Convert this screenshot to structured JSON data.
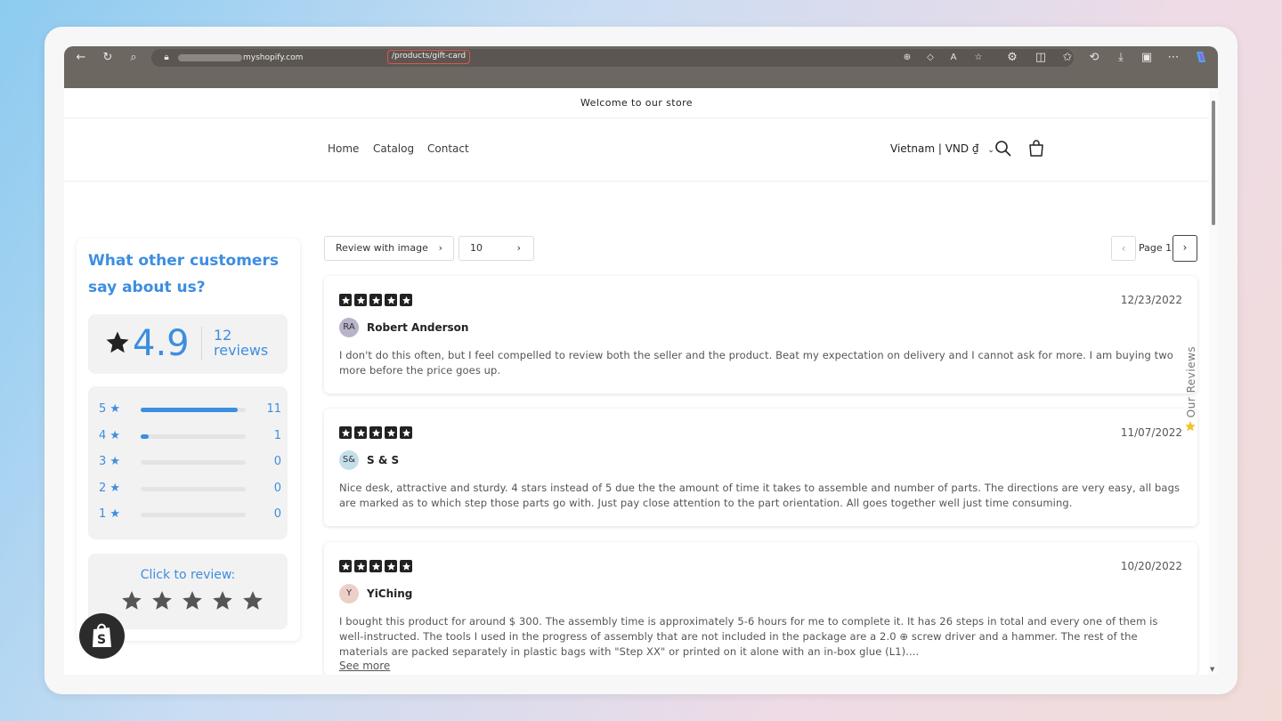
{
  "browser": {
    "url_domain": "myshopify.com",
    "url_path": "/products/gift-card"
  },
  "store": {
    "announcement": "Welcome to our store",
    "nav": [
      "Home",
      "Catalog",
      "Contact"
    ],
    "country": "Vietnam | VND ₫"
  },
  "summary": {
    "title": "What other customers say about us?",
    "rating": "4.9",
    "count_num": "12",
    "count_word": "reviews",
    "distribution": [
      {
        "label": "5 ★",
        "count": "11",
        "fraction": 0.92
      },
      {
        "label": "4 ★",
        "count": "1",
        "fraction": 0.08
      },
      {
        "label": "3 ★",
        "count": "0",
        "fraction": 0
      },
      {
        "label": "2 ★",
        "count": "0",
        "fraction": 0
      },
      {
        "label": "1 ★",
        "count": "0",
        "fraction": 0
      }
    ],
    "click_to_review": "Click to review:"
  },
  "toolbar": {
    "filter_label": "Review with image",
    "per_page": "10",
    "page_label": "Page 1"
  },
  "side_tab": "Our Reviews",
  "reviews": [
    {
      "date": "12/23/2022",
      "initials": "RA",
      "name": "Robert Anderson",
      "text": "I don't do this often, but I feel compelled to review both the seller and the product. Beat my expectation on delivery and I cannot ask for more. I am buying two more before the price goes up.",
      "avatar_color": "#b9b3c9"
    },
    {
      "date": "11/07/2022",
      "initials": "S&",
      "name": "S & S",
      "text": "Nice desk, attractive and sturdy. 4 stars instead of 5 due the the amount of time it takes to assemble and number of parts. The directions are very easy, all bags are marked as to which step those parts go with. Just pay close attention to the part orientation. All goes together well just time consuming.",
      "avatar_color": "#c4dfe9"
    },
    {
      "date": "10/20/2022",
      "initials": "Y",
      "name": "YiChing",
      "text": "I bought this product for around $ 300. The assembly time is approximately 5-6 hours for me to complete it. It has 26 steps in total and every one of them is well-instructed. The tools I used in the progress of assembly that are not included in the package are a 2.0 ⊕ screw driver and a hammer. The rest of the materials are packed separately in plastic bags with \"Step XX\" or printed on it alone with an in-box glue (L1)....",
      "see_more": "See more",
      "avatar_color": "#ecd0c8"
    }
  ]
}
